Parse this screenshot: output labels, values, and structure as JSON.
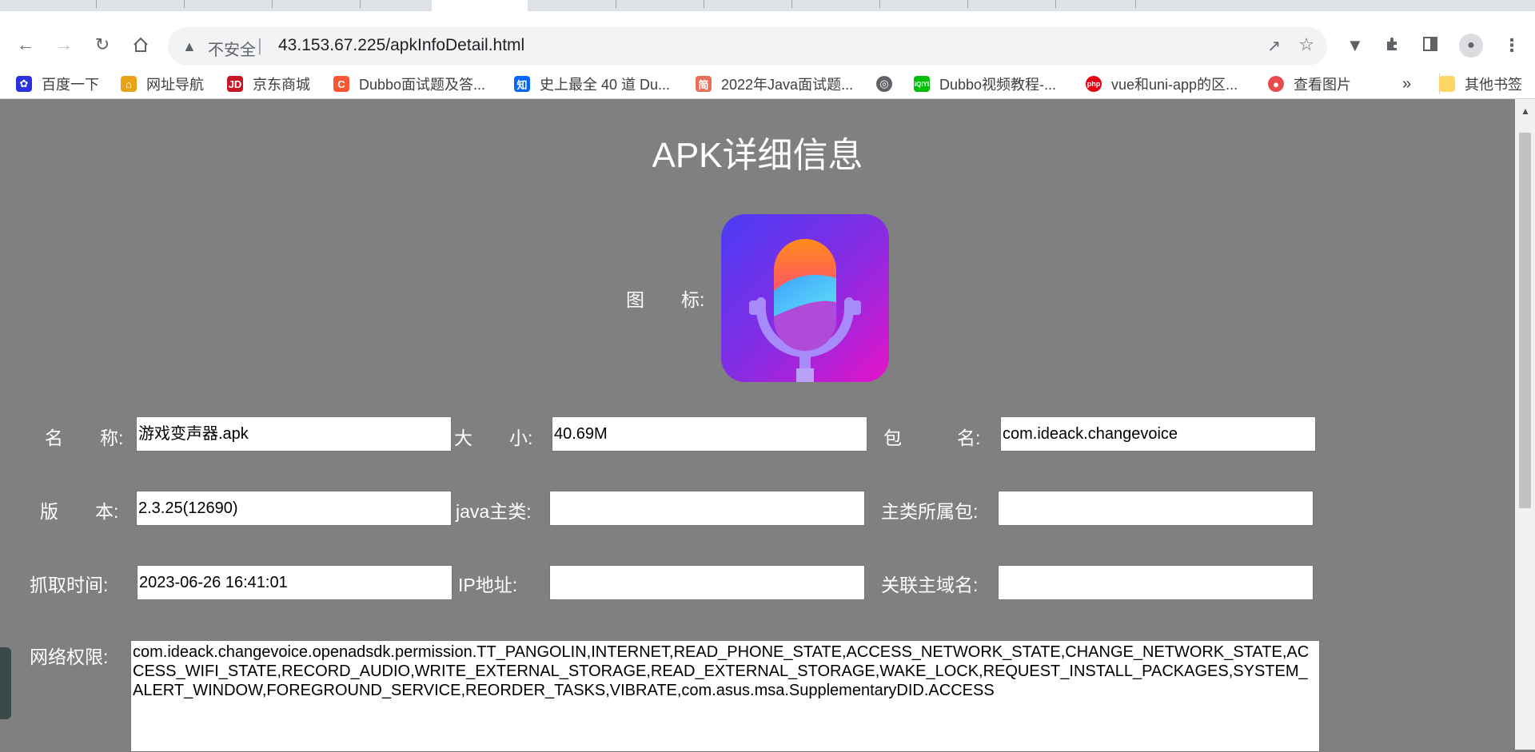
{
  "browser": {
    "insecure_label": "不安全",
    "url": "43.153.67.225/apkInfoDetail.html",
    "bookmarks": [
      {
        "label": "百度一下",
        "icon": "baidu-icon",
        "color": "#2932e1"
      },
      {
        "label": "网址导航",
        "icon": "2345-icon",
        "color": "#e8a317"
      },
      {
        "label": "京东商城",
        "icon": "jd-icon",
        "color": "#c81623"
      },
      {
        "label": "Dubbo面试题及答...",
        "icon": "csdn-icon",
        "color": "#fc5531"
      },
      {
        "label": "史上最全 40 道 Du...",
        "icon": "zhihu-icon",
        "color": "#0066ff"
      },
      {
        "label": "2022年Java面试题...",
        "icon": "jianshu-icon",
        "color": "#ea6f5a"
      },
      {
        "label": "",
        "icon": "globe-icon",
        "color": "#5f6368"
      },
      {
        "label": "Dubbo视频教程-...",
        "icon": "iqiyi-icon",
        "color": "#00be06"
      },
      {
        "label": "vue和uni-app的区...",
        "icon": "php-icon",
        "color": "#e60012"
      },
      {
        "label": "查看图片",
        "icon": "image-icon",
        "color": "#e84c4c"
      }
    ],
    "more_bookmarks": "»",
    "other_bookmarks": "其他书签"
  },
  "page": {
    "title": "APK详细信息",
    "icon_label": "图　　标:",
    "name_label": "名　　称:",
    "name_value": "游戏变声器.apk",
    "size_label": "大　　小:",
    "size_value": "40.69M",
    "package_label": "包　　　名:",
    "package_value": "com.ideack.changevoice",
    "version_label": "版　　本:",
    "version_value": "2.3.25(12690)",
    "main_class_label": "java主类:",
    "main_class_value": "",
    "main_class_pkg_label": "主类所属包:",
    "main_class_pkg_value": "",
    "fetch_time_label": "抓取时间:",
    "fetch_time_value": "2023-06-26 16:41:01",
    "ip_label": "IP地址:",
    "ip_value": "",
    "domain_label": "关联主域名:",
    "domain_value": "",
    "permissions_label": "网络权限:",
    "permissions_value": "com.ideack.changevoice.openadsdk.permission.TT_PANGOLIN,INTERNET,READ_PHONE_STATE,ACCESS_NETWORK_STATE,CHANGE_NETWORK_STATE,ACCESS_WIFI_STATE,RECORD_AUDIO,WRITE_EXTERNAL_STORAGE,READ_EXTERNAL_STORAGE,WAKE_LOCK,REQUEST_INSTALL_PACKAGES,SYSTEM_ALERT_WINDOW,FOREGROUND_SERVICE,REORDER_TASKS,VIBRATE,com.asus.msa.SupplementaryDID.ACCESS"
  }
}
